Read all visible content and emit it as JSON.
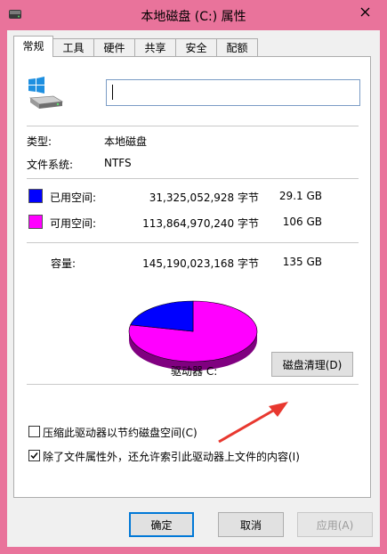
{
  "window": {
    "title": "本地磁盘 (C:) 属性"
  },
  "tabs": [
    "常规",
    "工具",
    "硬件",
    "共享",
    "安全",
    "配额"
  ],
  "active_tab": "常规",
  "general": {
    "name_value": "",
    "type_label": "类型:",
    "type_value": "本地磁盘",
    "fs_label": "文件系统:",
    "fs_value": "NTFS",
    "used": {
      "label": "已用空间:",
      "bytes": "31,325,052,928 字节",
      "size": "29.1 GB",
      "color": "#0000ff"
    },
    "free": {
      "label": "可用空间:",
      "bytes": "113,864,970,240 字节",
      "size": "106 GB",
      "color": "#ff00ff"
    },
    "capacity": {
      "label": "容量:",
      "bytes": "145,190,023,168 字节",
      "size": "135 GB"
    },
    "used_fraction": 0.216,
    "drive_label": "驱动器 C:",
    "cleanup_button": "磁盘清理(D)",
    "compress_label": "压缩此驱动器以节约磁盘空间(C)",
    "compress_checked": false,
    "index_label": "除了文件属性外，还允许索引此驱动器上文件的内容(I)",
    "index_checked": true
  },
  "footer": {
    "ok": "确定",
    "cancel": "取消",
    "apply": "应用(A)"
  },
  "colors": {
    "accent": "#0078d7",
    "frame": "#e9739b",
    "annotation_arrow": "#e8382f"
  }
}
